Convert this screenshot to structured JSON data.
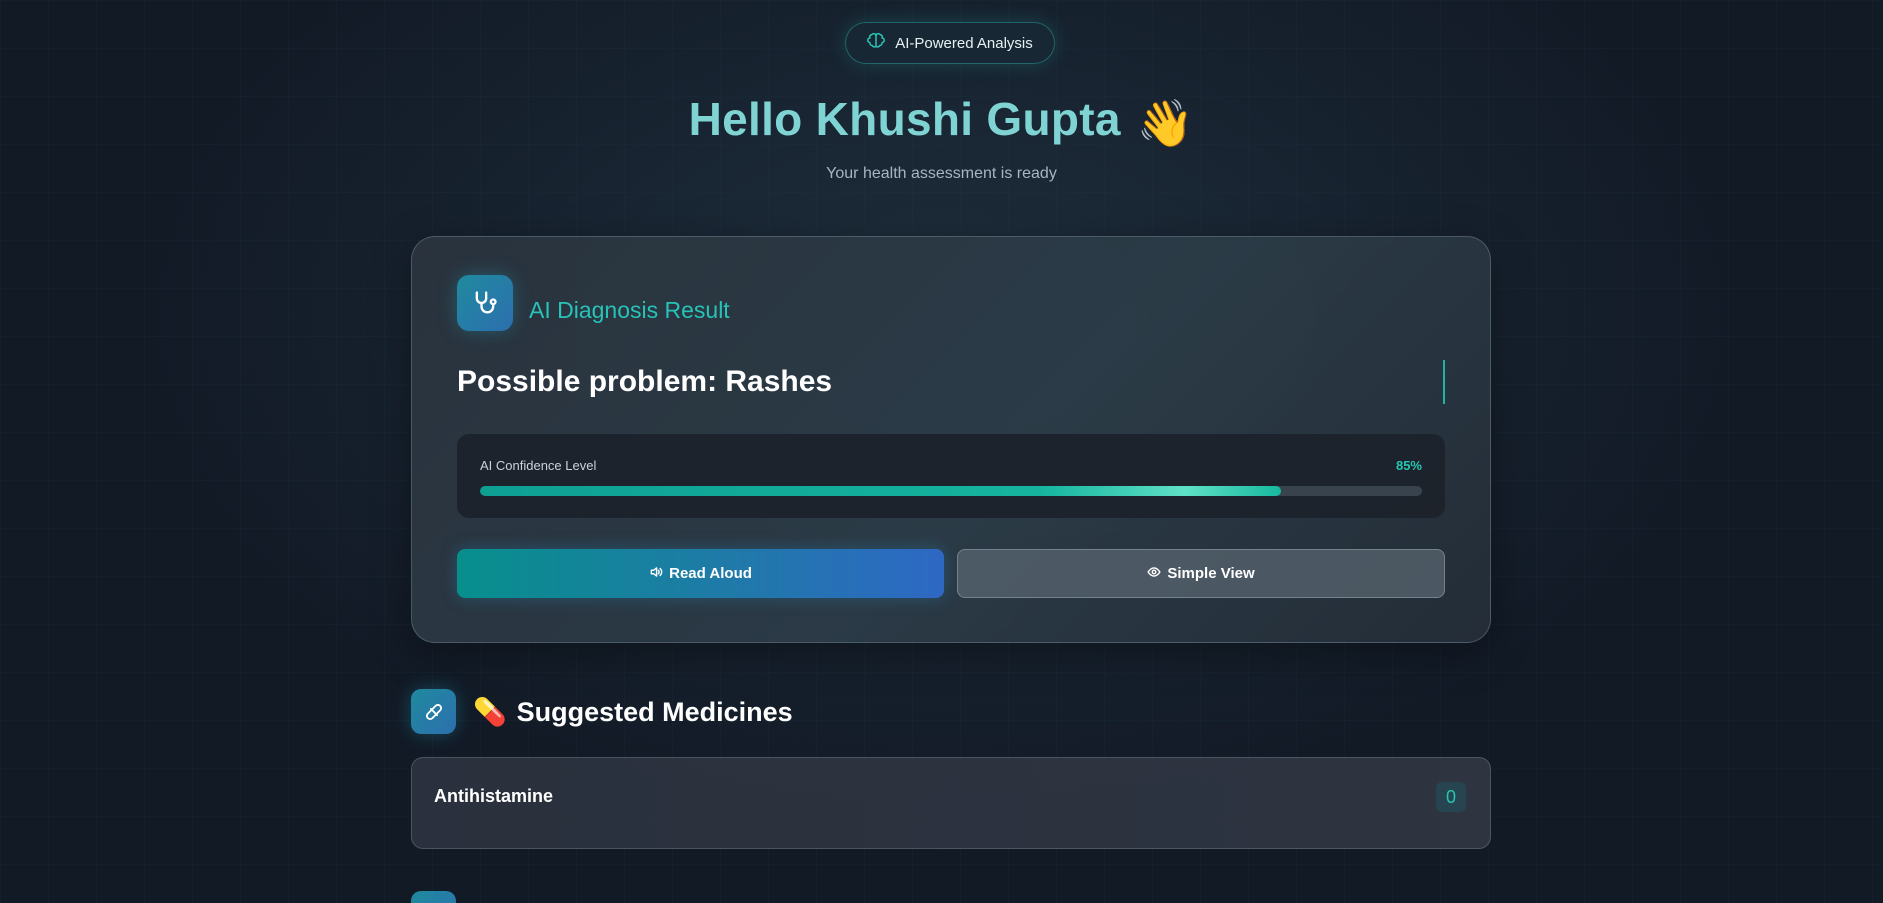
{
  "header": {
    "badge_icon": "brain-icon",
    "badge_label": "AI-Powered Analysis",
    "greeting": "Hello Khushi Gupta",
    "greeting_emoji": "👋",
    "subtitle": "Your health assessment is ready"
  },
  "diagnosis": {
    "icon": "stethoscope-icon",
    "title": "AI Diagnosis Result",
    "problem": "Possible problem: Rashes",
    "confidence_label": "AI Confidence Level",
    "confidence_text": "85%",
    "confidence_value": 0.85,
    "read_aloud_icon": "speaker-icon",
    "read_aloud_label": "Read Aloud",
    "simple_view_icon": "eye-icon",
    "simple_view_label": "Simple View"
  },
  "medicines": {
    "icon": "pill-icon",
    "title_emoji": "💊",
    "title": "Suggested Medicines",
    "items": [
      {
        "name": "Antihistamine",
        "count": "0"
      }
    ]
  },
  "colors": {
    "accent": "#26c6b2",
    "background": "#121a26",
    "title": "#7fd3d3"
  }
}
